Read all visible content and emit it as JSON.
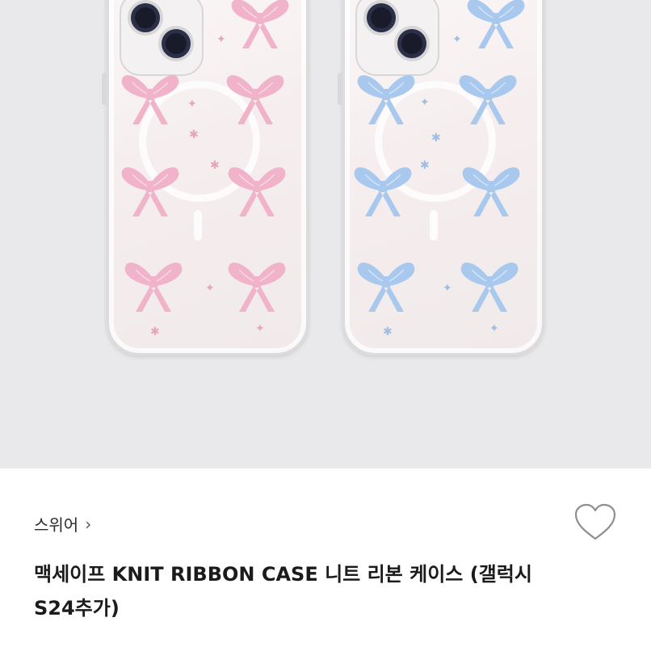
{
  "product": {
    "brand": "스위어",
    "title": "맥세이프 KNIT RIBBON CASE 니트 리본 케이스 (갤럭시S24추가)"
  },
  "image": {
    "background": "#e9e9eb",
    "cases": [
      {
        "name": "pink",
        "bow_color": "#f0b3c9",
        "sparkle_color": "#e5a5bd"
      },
      {
        "name": "blue",
        "bow_color": "#a9c8ee",
        "sparkle_color": "#9fbde5"
      }
    ]
  },
  "icons": {
    "chevron": "chevron-right-icon",
    "like": "heart-outline-icon"
  }
}
